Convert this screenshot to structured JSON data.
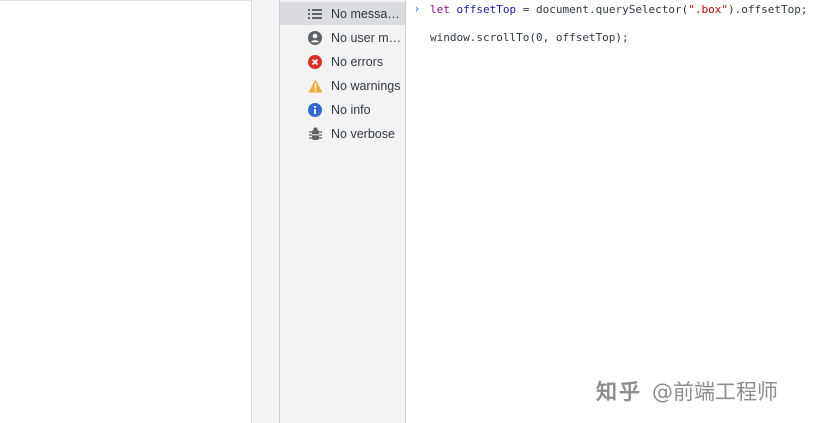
{
  "sidebar": {
    "items": [
      {
        "label": "No messages",
        "icon": "list-icon",
        "selected": true
      },
      {
        "label": "No user me...",
        "icon": "user-icon",
        "selected": false
      },
      {
        "label": "No errors",
        "icon": "error-icon",
        "selected": false
      },
      {
        "label": "No warnings",
        "icon": "warning-icon",
        "selected": false
      },
      {
        "label": "No info",
        "icon": "info-icon",
        "selected": false
      },
      {
        "label": "No verbose",
        "icon": "bug-icon",
        "selected": false
      }
    ]
  },
  "console": {
    "prompt": "›",
    "line1": {
      "kw": "let",
      "var": "offsetTop",
      "mid": " = document.querySelector(",
      "str": "\".box\"",
      "end": ").offsetTop;"
    },
    "line2": "window.scrollTo(0, offsetTop);"
  },
  "watermark": {
    "logo": "知乎",
    "text": "@前端工程师"
  },
  "colors": {
    "error": "#d93025",
    "warning": "#f2a93b",
    "info": "#3367d6",
    "icon": "#5f6368",
    "keyword": "#881280",
    "variable": "#1a1aa6",
    "string": "#c80000"
  }
}
